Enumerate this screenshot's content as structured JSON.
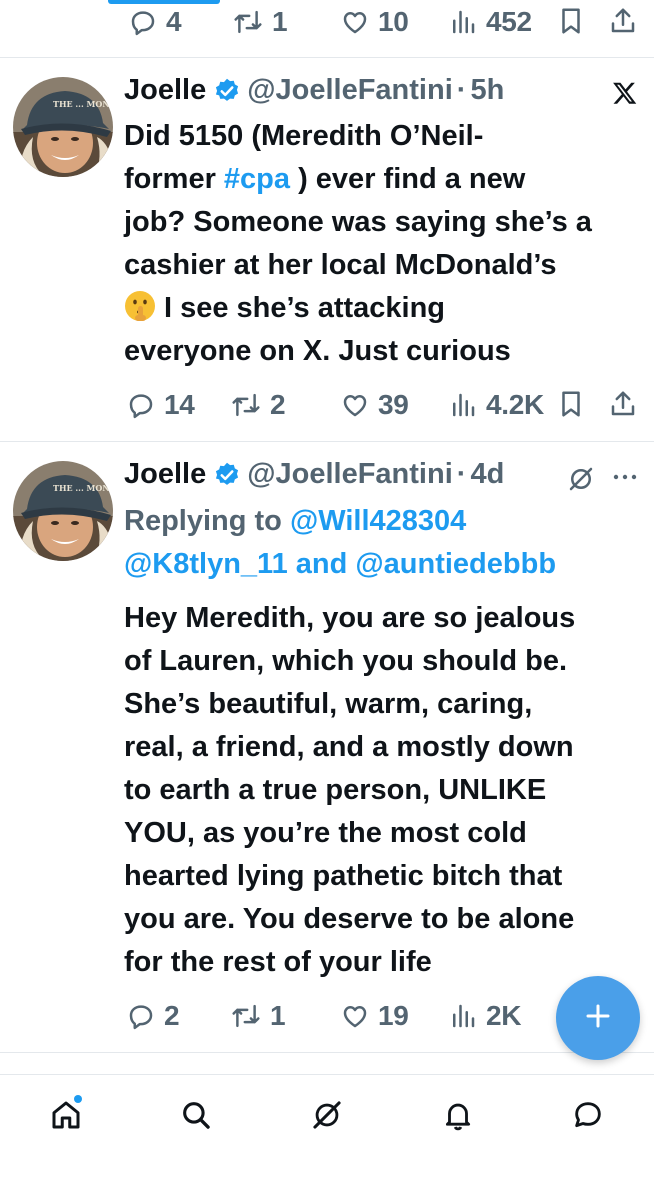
{
  "top_actions": {
    "replies": "4",
    "reposts": "1",
    "likes": "10",
    "views": "452"
  },
  "tweets": [
    {
      "name": "Joelle",
      "handle": "@JoelleFantini",
      "dot": "·",
      "time": "5h",
      "text_l1": "Did 5150 (Meredith O’Neil-",
      "text_l2_a": "former ",
      "text_l2_hashtag": "#cpa",
      "text_l2_b": " ) ever find a new",
      "text_l3": "job? Someone was saying she’s a",
      "text_l4": "cashier at her local McDonald’s",
      "text_l5": "I see she’s attacking",
      "text_l6": "everyone on X. Just curious",
      "stats": {
        "replies": "14",
        "reposts": "2",
        "likes": "39",
        "views": "4.2K"
      }
    },
    {
      "name": "Joelle",
      "handle": "@JoelleFantini",
      "dot": "·",
      "time": "4d",
      "replying_prefix": "Replying to ",
      "replying_mention1": "@Will428304",
      "replying_mention2": "@K8tlyn_11",
      "replying_and": " and ",
      "replying_mention3": "@auntiedebbb",
      "lines": [
        "Hey Meredith, you are so jealous",
        "of Lauren, which you should be.",
        "She’s beautiful, warm, caring,",
        "real, a friend, and a mostly down",
        "to earth a true person, UNLIKE",
        "YOU, as you’re the most cold",
        "hearted lying pathetic bitch that",
        "you are. You deserve to be alone",
        "for the rest of your life"
      ],
      "stats": {
        "replies": "2",
        "reposts": "1",
        "likes": "19",
        "views": "2K"
      }
    }
  ],
  "avatar_cap_text": "THE ... MONEY",
  "colors": {
    "accent": "#1d9bf0",
    "text": "#0f1419",
    "muted": "#536471",
    "divider": "#e4e8ec",
    "fab": "#4a9fe9"
  },
  "icons": {
    "platform": "x-logo-icon",
    "verified": "verified-badge-icon",
    "grok": "grok-icon",
    "more": "more-icon",
    "emoji": "shushing-face-emoji",
    "fab": "plus-icon",
    "nav": [
      "home-icon",
      "search-icon",
      "grok-icon",
      "notifications-icon",
      "messages-icon"
    ]
  }
}
